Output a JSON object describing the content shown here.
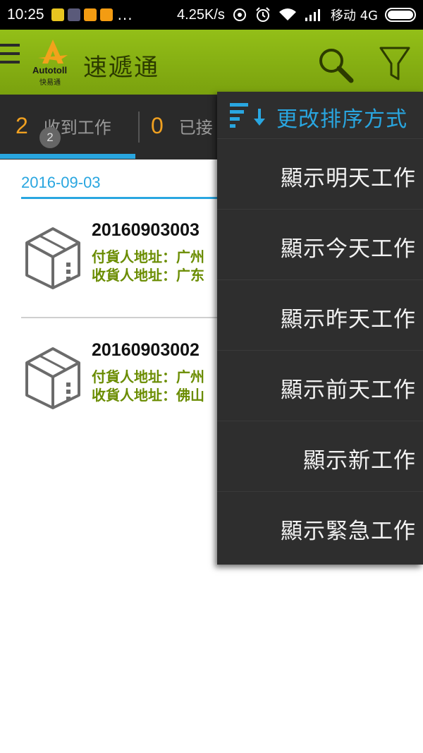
{
  "status_bar": {
    "time": "10:25",
    "more": "...",
    "net_speed": "4.25K/s",
    "carrier": "移动 4G",
    "app_icon_colors": [
      "#e8c520",
      "#5a5a7a",
      "#f39c12",
      "#f39c12"
    ]
  },
  "toolbar": {
    "menu_icon": "hamburger-menu-icon",
    "logo_text": "Autotoll",
    "logo_sub": "快易通",
    "title": "速遞通",
    "search_icon": "search-icon",
    "filter_icon": "filter-icon",
    "bar_color": "#88b214"
  },
  "tabs": [
    {
      "count": "2",
      "label": "收到工作",
      "badge": "2",
      "active": true
    },
    {
      "count": "0",
      "label": "已接"
    }
  ],
  "content": {
    "date": "2016-09-03",
    "jobs": [
      {
        "id": "20160903003",
        "shipper_label": "付貨人地址：广州",
        "receiver_label": "收貨人地址：广东"
      },
      {
        "id": "20160903002",
        "shipper_label": "付貨人地址：广州",
        "receiver_label": "收貨人地址：佛山"
      }
    ]
  },
  "sort_menu": {
    "header": "更改排序方式",
    "items": [
      {
        "label": "顯示明天工作"
      },
      {
        "label": "顯示今天工作"
      },
      {
        "label": "顯示昨天工作"
      },
      {
        "label": "顯示前天工作"
      },
      {
        "label": "顯示新工作"
      },
      {
        "label": "顯示緊急工作"
      }
    ]
  },
  "colors": {
    "accent_blue": "#29a6e0",
    "count_orange": "#f0a020",
    "address_green": "#6a8c00",
    "menu_bg": "#2e2e2e"
  }
}
